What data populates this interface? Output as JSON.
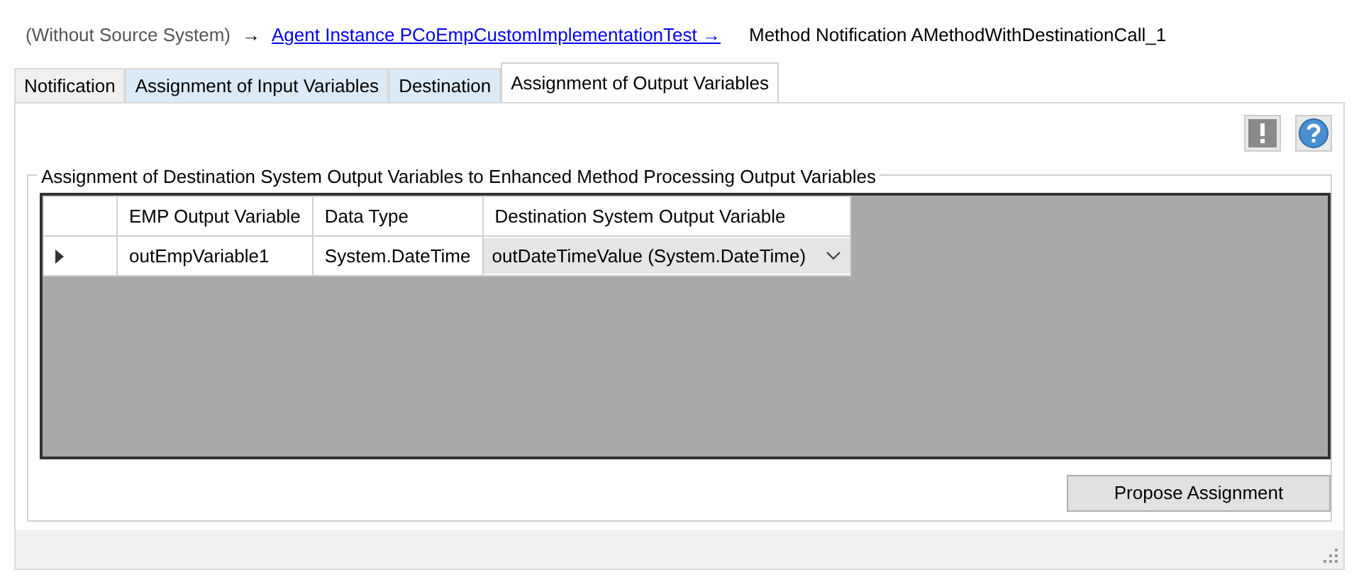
{
  "breadcrumb": [
    {
      "kind": "text",
      "text": "(Without Source System)"
    },
    {
      "kind": "arrow",
      "text": "→"
    },
    {
      "kind": "link",
      "text": "Agent Instance PCoEmpCustomImplementationTest  →"
    },
    {
      "kind": "current",
      "text": "Method Notification AMethodWithDestinationCall_1"
    }
  ],
  "tabs": [
    {
      "label": "Notification",
      "selected": false,
      "highlighted": false
    },
    {
      "label": "Assignment of Input Variables",
      "selected": false,
      "highlighted": true
    },
    {
      "label": "Destination",
      "selected": false,
      "highlighted": true
    },
    {
      "label": "Assignment of Output Variables",
      "selected": true,
      "highlighted": false
    }
  ],
  "toolbar": [
    {
      "kind": "warning",
      "disabled": true
    },
    {
      "kind": "help",
      "disabled": false
    }
  ],
  "group": {
    "title": "Assignment of Destination System Output Variables to Enhanced Method Processing Output Variables",
    "table": {
      "columns": [
        "EMP Output Variable",
        "Data Type",
        "Destination System Output Variable"
      ],
      "rows": [
        {
          "current": true,
          "cells": [
            "outEmpVariable1",
            "System.DateTime",
            "outDateTimeValue (System.DateTime)"
          ]
        }
      ]
    }
  },
  "buttons": [
    "Propose Assignment"
  ]
}
